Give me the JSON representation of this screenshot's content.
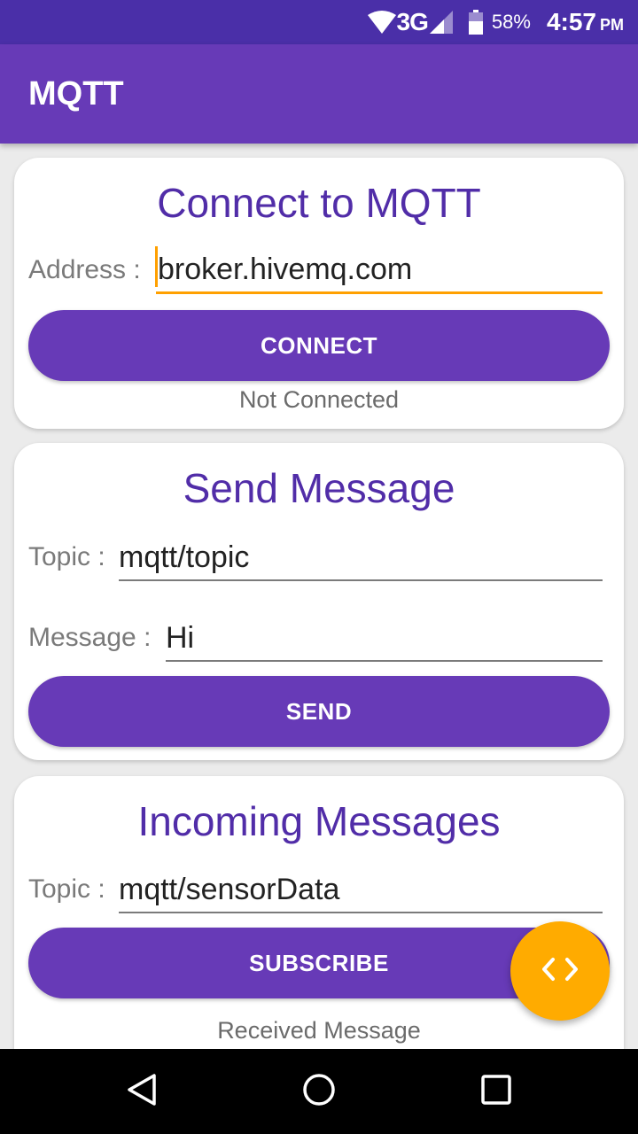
{
  "status_bar": {
    "network": "3G",
    "battery": "58%",
    "time": "4:57",
    "ampm": "PM",
    "icons": [
      "wifi-icon",
      "signal-icon",
      "battery-icon"
    ]
  },
  "app_bar": {
    "title": "MQTT"
  },
  "connect_card": {
    "title": "Connect to MQTT",
    "address_label": "Address :",
    "address_value": "broker.hivemq.com",
    "connect_label": "CONNECT",
    "status": "Not Connected"
  },
  "send_card": {
    "title": "Send Message",
    "topic_label": "Topic :",
    "topic_value": "mqtt/topic",
    "message_label": "Message :",
    "message_value": "Hi",
    "send_label": "SEND"
  },
  "incoming_card": {
    "title": "Incoming Messages",
    "topic_label": "Topic :",
    "topic_value": "mqtt/sensorData",
    "subscribe_label": "SUBSCRIBE",
    "received_label": "Received Message"
  },
  "fab": {
    "icon": "code-icon"
  },
  "nav_bar": {
    "icons": [
      "back-icon",
      "home-icon",
      "recents-icon"
    ]
  },
  "colors": {
    "primary": "#673ab7",
    "primary_dark": "#4a2fa8",
    "accent": "#ffab00",
    "title_text": "#512da8"
  }
}
